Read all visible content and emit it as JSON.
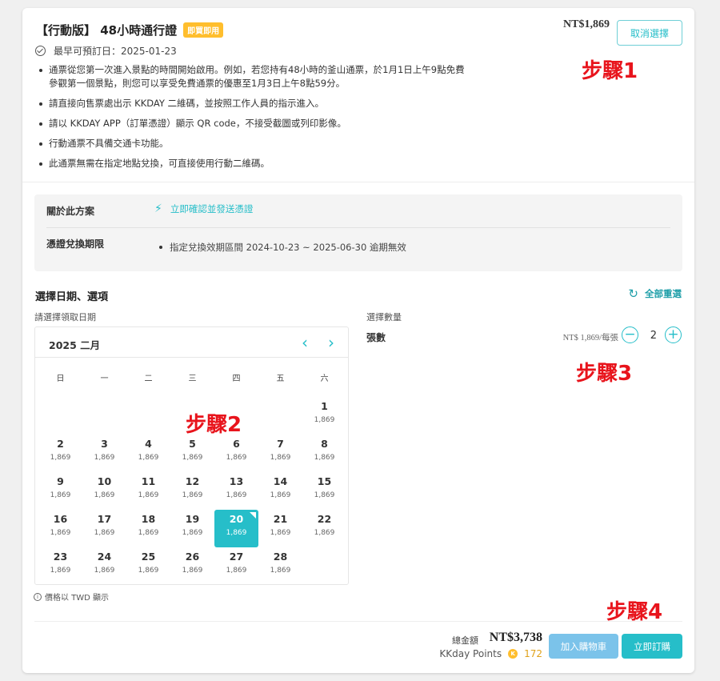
{
  "product": {
    "title": "【行動版】 48小時通行證",
    "badge": "即買即用",
    "price": "NT$1,869",
    "cancel_label": "取消選擇",
    "earliest_label": "最早可預訂日：2025-01-23",
    "notes": [
      "通票從您第一次進入景點的時間開始啟用。例如，若您持有48小時的釜山通票，於1月1日上午9點免費參觀第一個景點，則您可以享受免費通票的優惠至1月3日上午8點59分。",
      "請直接向售票處出示 KKDAY 二維碼，並按照工作人員的指示進入。",
      "請以 KKDAY APP（訂單憑證）顯示 QR code，不接受截圖或列印影像。",
      "行動通票不具備交通卡功能。",
      "此通票無需在指定地點兌換，可直接使用行動二維碼。"
    ]
  },
  "steps": {
    "step1": "步驟1",
    "step2": "步驟2",
    "step3": "步驟3",
    "step4": "步驟4"
  },
  "about": {
    "label": "關於此方案",
    "link": "立即確認並發送憑證",
    "redeem_label": "憑證兌換期限",
    "redeem_text": "指定兌換效期區間 2024-10-23 ~ 2025-06-30 逾期無效"
  },
  "selection": {
    "title": "選擇日期、選項",
    "reset_label": "全部重選",
    "date_label": "請選擇領取日期",
    "qty_section_label": "選擇數量"
  },
  "calendar": {
    "month_label": "2025 二月",
    "weekdays": [
      "日",
      "一",
      "二",
      "三",
      "四",
      "五",
      "六"
    ],
    "first_weekday": 6,
    "days": [
      {
        "day": "1",
        "price": "1,869"
      },
      {
        "day": "2",
        "price": "1,869"
      },
      {
        "day": "3",
        "price": "1,869"
      },
      {
        "day": "4",
        "price": "1,869"
      },
      {
        "day": "5",
        "price": "1,869"
      },
      {
        "day": "6",
        "price": "1,869"
      },
      {
        "day": "7",
        "price": "1,869"
      },
      {
        "day": "8",
        "price": "1,869"
      },
      {
        "day": "9",
        "price": "1,869"
      },
      {
        "day": "10",
        "price": "1,869"
      },
      {
        "day": "11",
        "price": "1,869"
      },
      {
        "day": "12",
        "price": "1,869"
      },
      {
        "day": "13",
        "price": "1,869"
      },
      {
        "day": "14",
        "price": "1,869"
      },
      {
        "day": "15",
        "price": "1,869"
      },
      {
        "day": "16",
        "price": "1,869"
      },
      {
        "day": "17",
        "price": "1,869"
      },
      {
        "day": "18",
        "price": "1,869"
      },
      {
        "day": "19",
        "price": "1,869"
      },
      {
        "day": "20",
        "price": "1,869"
      },
      {
        "day": "21",
        "price": "1,869"
      },
      {
        "day": "22",
        "price": "1,869"
      },
      {
        "day": "23",
        "price": "1,869"
      },
      {
        "day": "24",
        "price": "1,869"
      },
      {
        "day": "25",
        "price": "1,869"
      },
      {
        "day": "26",
        "price": "1,869"
      },
      {
        "day": "27",
        "price": "1,869"
      },
      {
        "day": "28",
        "price": "1,869"
      }
    ],
    "selected_day": "20",
    "price_note": "價格以 TWD 顯示"
  },
  "quantity": {
    "label": "張數",
    "unit_price": "NT$ 1,869/每張",
    "value": "2"
  },
  "footer": {
    "total_label": "總金額",
    "total_value": "NT$3,738",
    "points_label": "KKday Points",
    "points_value": "172",
    "add_cart_label": "加入購物車",
    "order_label": "立即訂購"
  },
  "colors": {
    "accent": "#26bec9",
    "step_red": "#e8141c",
    "badge": "#ffbe2d",
    "cart_button": "#7bc3ea"
  }
}
